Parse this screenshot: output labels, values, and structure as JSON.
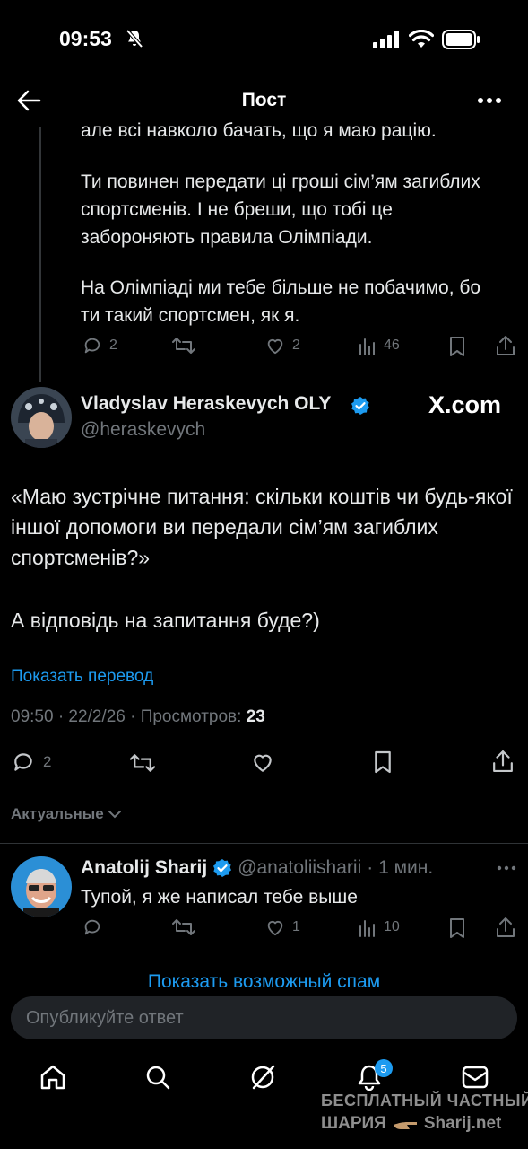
{
  "status_bar": {
    "time": "09:53"
  },
  "header": {
    "title": "Пост"
  },
  "quoted_post": {
    "line_cut": "але всі навколо бачать, що я маю рацію.",
    "para2": "Ти повинен передати ці гроші сім’ям загиблих спортсменів. І не бреши, що тобі це забороняють правила Олімпіади.",
    "para3": "На Олімпіаді ми тебе більше не побачимо, бо ти такий спортсмен, як я.",
    "replies": "2",
    "likes": "2",
    "views": "46"
  },
  "main_post": {
    "author_name": "Vladyslav Heraskevych OLY",
    "handle": "@heraskevych",
    "watermark": "X.com",
    "para1": "«Маю зустрічне питання: скільки коштів чи будь-якої іншої допомоги ви передали сім’ям загиблих спортсменів?»",
    "para2": "А відповідь на запитання буде?)",
    "translate": "Показать перевод",
    "meta": "09:50 · 22/2/26 · Просмотров:",
    "views": "23",
    "replies": "2"
  },
  "sort": {
    "label": "Актуальные"
  },
  "reply": {
    "author_name": "Anatolij Sharij",
    "handle": "@anatoliisharii",
    "time": "· 1 мин.",
    "text": "Тупой, я же написал тебе выше",
    "likes": "1",
    "views": "10"
  },
  "spam_link": "Показать возможный спам",
  "composer": {
    "placeholder": "Опубликуйте ответ"
  },
  "nav": {
    "notifications_count": "5"
  },
  "overlay_watermark": {
    "line1": "БЕСПЛАТНЫЙ ЧАСТНЫЙ",
    "line2": "ШАРИЯ",
    "line3": "Sharij.net"
  },
  "colors": {
    "accent": "#1d9bf0",
    "background": "#000000",
    "muted": "#71767b"
  }
}
